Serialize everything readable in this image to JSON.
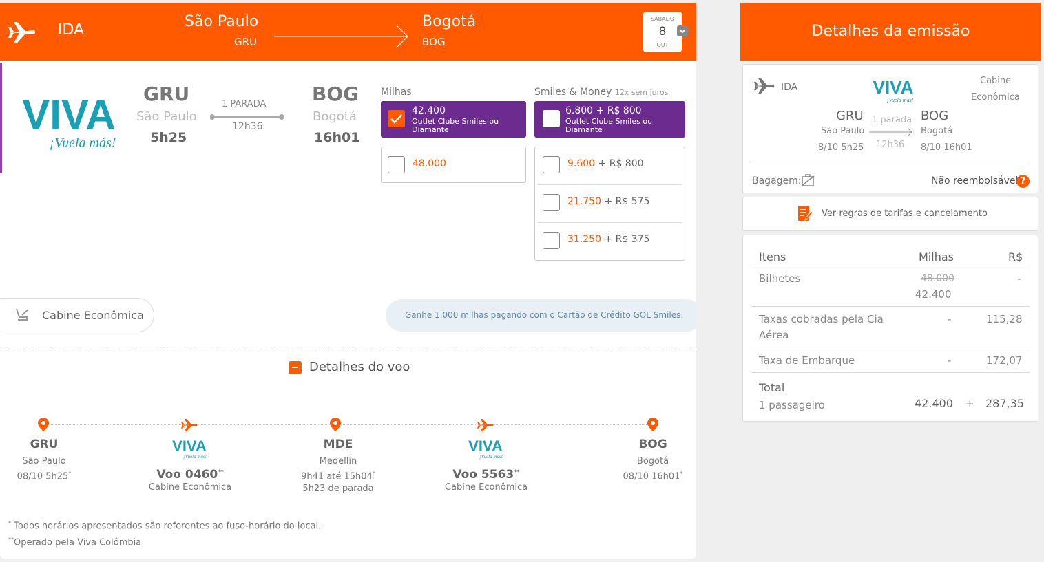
{
  "header": {
    "direction": "IDA",
    "origin_city": "São Paulo",
    "origin_code": "GRU",
    "destination_city": "Bogotá",
    "destination_code": "BOG",
    "date": {
      "weekday": "SÁBADO",
      "day": "8",
      "month": "OUT"
    }
  },
  "flight": {
    "airline_logo": "VIVA",
    "airline_tagline": "¡Vuela más!",
    "origin_code": "GRU",
    "origin_city": "São Paulo",
    "origin_time": "5h25",
    "stops": "1 PARADA",
    "duration": "12h36",
    "destination_code": "BOG",
    "destination_city": "Bogotá",
    "destination_time": "16h01"
  },
  "fares": {
    "miles_title": "Milhas",
    "sm_title": "Smiles & Money",
    "sm_subtitle": "12x sem juros",
    "miles_selected": {
      "value": "42.400",
      "desc": "Outlet Clube Smiles ou Diamante"
    },
    "sm_selected": {
      "value": "6.800 + R$ 800",
      "desc": "Outlet Clube Smiles ou Diamante"
    },
    "miles_option": "48.000",
    "sm_options": [
      {
        "miles": "9.600",
        "money": " + R$ 800"
      },
      {
        "miles": "21.750",
        "money": " + R$ 575"
      },
      {
        "miles": "31.250",
        "money": " + R$ 375"
      }
    ]
  },
  "cabin": "Cabine Econômica",
  "promo": "Ganhe 1.000 milhas pagando com o Cartão de Crédito GOL Smiles.",
  "details_title": "Detalhes do voo",
  "timeline": {
    "gru": {
      "code": "GRU",
      "city": "São Paulo",
      "time": "08/10 5h25"
    },
    "voo1": {
      "label": "Voo 0460",
      "mark": "**",
      "cabin": "Cabine Econômica"
    },
    "mde": {
      "code": "MDE",
      "city": "Medellín",
      "time": "9h41 até 15h04",
      "stop": "5h23 de parada"
    },
    "voo2": {
      "label": "Voo 5563",
      "mark": "**",
      "cabin": "Cabine Econômica"
    },
    "bog": {
      "code": "BOG",
      "city": "Bogotá",
      "time": "08/10 16h01"
    }
  },
  "footnotes": {
    "one_mark": "*",
    "one": "Todos horários apresentados são referentes ao fuso-horário do local.",
    "two_mark": "**",
    "two": "Operado pela Viva Colômbia"
  },
  "summary": {
    "title": "Detalhes da emissão",
    "direction": "IDA",
    "cabin_line1": "Cabine",
    "cabin_line2": "Econômica",
    "origin_code": "GRU",
    "origin_city": "São Paulo",
    "origin_datetime": "8/10 5h25",
    "stops": "1 parada",
    "duration": "12h36",
    "destination_code": "BOG",
    "destination_city": "Bogotá",
    "destination_datetime": "8/10 16h01",
    "baggage_label": "Bagagem:",
    "refund": "Não reembolsável",
    "rules_link": "Ver regras de tarifas e cancelamento"
  },
  "pricing": {
    "col_items": "Itens",
    "col_miles": "Milhas",
    "col_money": "R$",
    "rows": [
      {
        "item": "Bilhetes",
        "miles_old": "48.000",
        "miles": "42.400",
        "money": "-"
      },
      {
        "item": "Taxas cobradas pela Cia",
        "item2": "Aérea",
        "miles": "-",
        "money": "115,28"
      },
      {
        "item": "Taxa de Embarque",
        "miles": "-",
        "money": "172,07"
      }
    ],
    "total_label": "Total",
    "passengers": "1 passageiro",
    "total_miles": "42.400",
    "plus": "+",
    "total_money": "287,35"
  },
  "colors": {
    "brand": "#ff5a00",
    "fare_purple": "#6c2c8f",
    "viva_teal": "#1aa0b4"
  }
}
